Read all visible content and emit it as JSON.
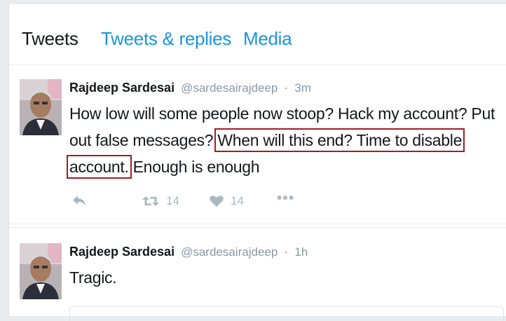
{
  "tabs": [
    {
      "label": "Tweets",
      "active": true
    },
    {
      "label": "Tweets & replies",
      "active": false
    },
    {
      "label": "Media",
      "active": false
    }
  ],
  "tweets": [
    {
      "name": "Rajdeep Sardesai",
      "handle": "@sardesairajdeep",
      "separator": "·",
      "time": "3m",
      "text_before": "How low will some people now stoop? Hack my account? Put out false messages? ",
      "text_highlight": "When will this end? Time to disable account.",
      "text_after": " Enough is enough",
      "actions": {
        "reply_icon": "reply-icon",
        "retweet_icon": "retweet-icon",
        "retweets": "14",
        "like_icon": "heart-icon",
        "likes": "14",
        "more_icon": "more-icon"
      }
    },
    {
      "name": "Rajdeep Sardesai",
      "handle": "@sardesairajdeep",
      "separator": "·",
      "time": "1h",
      "text": "Tragic."
    }
  ],
  "colors": {
    "link_blue": "#1b95e0",
    "text_dark": "#14171a",
    "muted": "#8899a6",
    "action_gray": "#aab8c2",
    "highlight_box": "#a01d24"
  }
}
